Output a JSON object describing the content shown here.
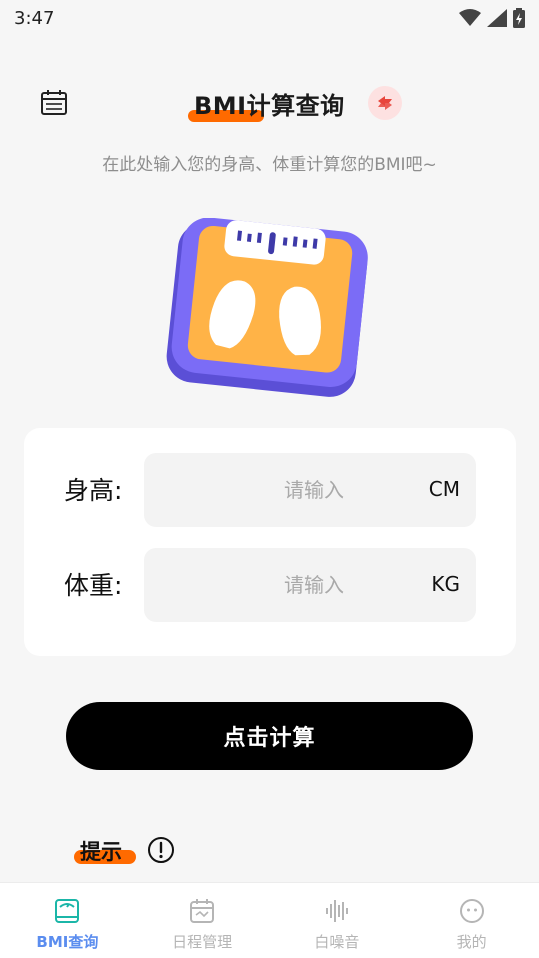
{
  "status_bar": {
    "time": "3:47"
  },
  "header": {
    "title": "BMI计算查询",
    "calendar_icon": "calendar-icon",
    "switch_icon": "switch-arrows-icon"
  },
  "subtitle": "在此处输入您的身高、体重计算您的BMI吧~",
  "form": {
    "height": {
      "label": "身高:",
      "placeholder": "请输入",
      "unit": "CM",
      "value": ""
    },
    "weight": {
      "label": "体重:",
      "placeholder": "请输入",
      "unit": "KG",
      "value": ""
    }
  },
  "calc_button_label": "点击计算",
  "tip": {
    "label": "提示",
    "icon": "info-icon"
  },
  "tabs": [
    {
      "label": "BMI查询",
      "icon": "scale-icon",
      "active": true
    },
    {
      "label": "日程管理",
      "icon": "calendar-icon",
      "active": false
    },
    {
      "label": "白噪音",
      "icon": "waveform-icon",
      "active": false
    },
    {
      "label": "我的",
      "icon": "face-icon",
      "active": false
    }
  ],
  "colors": {
    "accent_orange": "#ff6a00",
    "tab_active": "#5b8def",
    "scale_body": "#7b6cf6",
    "scale_pad": "#ffb347"
  }
}
